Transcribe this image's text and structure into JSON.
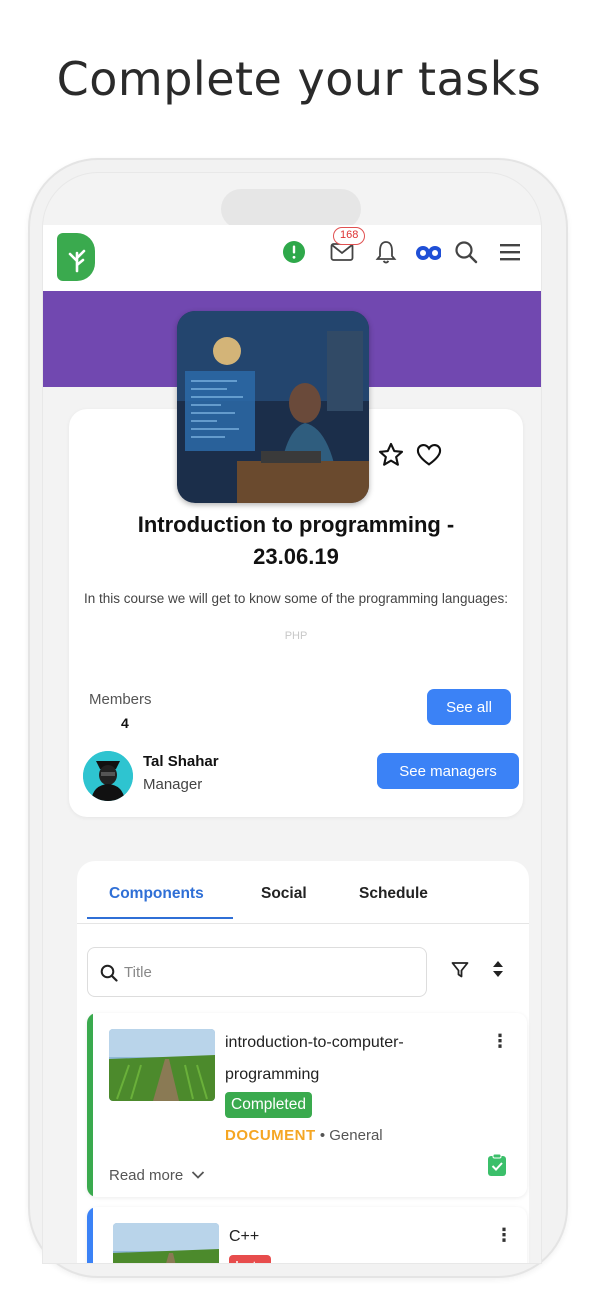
{
  "headline": "Complete your tasks",
  "header": {
    "notification_count": "168",
    "icons": [
      "alert-icon",
      "mail-icon",
      "bell-icon",
      "binoculars-icon",
      "search-icon",
      "menu-icon"
    ]
  },
  "course": {
    "title_line1": "Introduction to programming -",
    "title_line2": "23.06.19",
    "description": "In this course we will get to know some of the programming languages:",
    "language_hint": "PHP",
    "members_label": "Members",
    "members_count": "4",
    "see_all_label": "See all",
    "manager_name": "Tal Shahar",
    "manager_role": "Manager",
    "see_managers_label": "See managers"
  },
  "tabs": [
    "Components",
    "Social",
    "Schedule"
  ],
  "search": {
    "placeholder": "Title"
  },
  "items": [
    {
      "name": "introduction-to-computer-programming",
      "name_line1": "introduction-to-computer-",
      "name_line2": "programming",
      "status": "Completed",
      "kind": "DOCUMENT",
      "category": "General",
      "read_more": "Read more"
    },
    {
      "name": "C++",
      "status": "Late"
    }
  ],
  "colors": {
    "brand_green": "#3aaa4e",
    "purple": "#7148b0",
    "blue": "#3b82f6",
    "completed": "#3aaa4e",
    "late": "#e74c4c",
    "document": "#f5a623"
  }
}
